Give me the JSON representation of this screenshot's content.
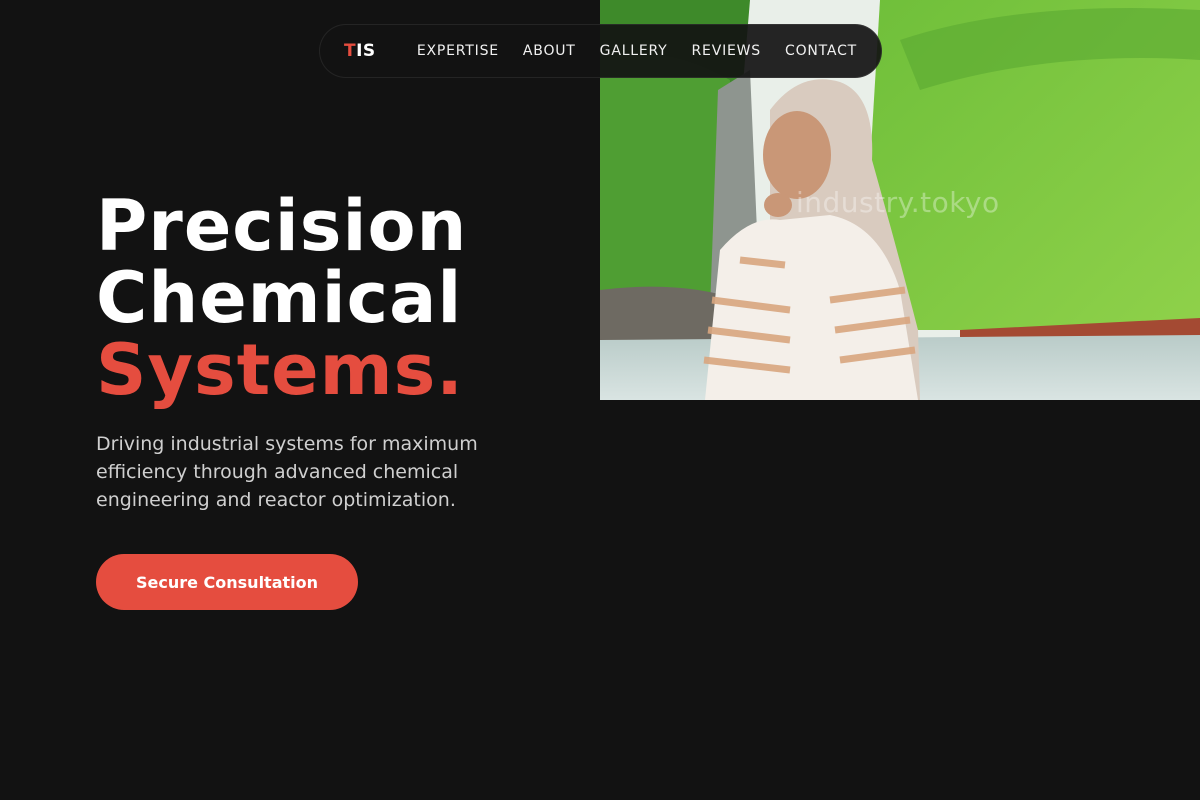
{
  "nav": {
    "logo_accent": "T",
    "logo_rest": "IS",
    "links": [
      "EXPERTISE",
      "ABOUT",
      "GALLERY",
      "REVIEWS",
      "CONTACT"
    ]
  },
  "hero": {
    "line1": "Precision",
    "line2": "Chemical",
    "line3": "Systems.",
    "subtitle": "Driving industrial systems for maximum efficiency through advanced chemical engineering and reactor optimization.",
    "cta_label": "Secure Consultation",
    "image_watermark": "industry.tokyo"
  },
  "colors": {
    "background": "#121212",
    "accent": "#e54d3f",
    "text": "#ffffff",
    "muted": "#cfcfcf"
  }
}
